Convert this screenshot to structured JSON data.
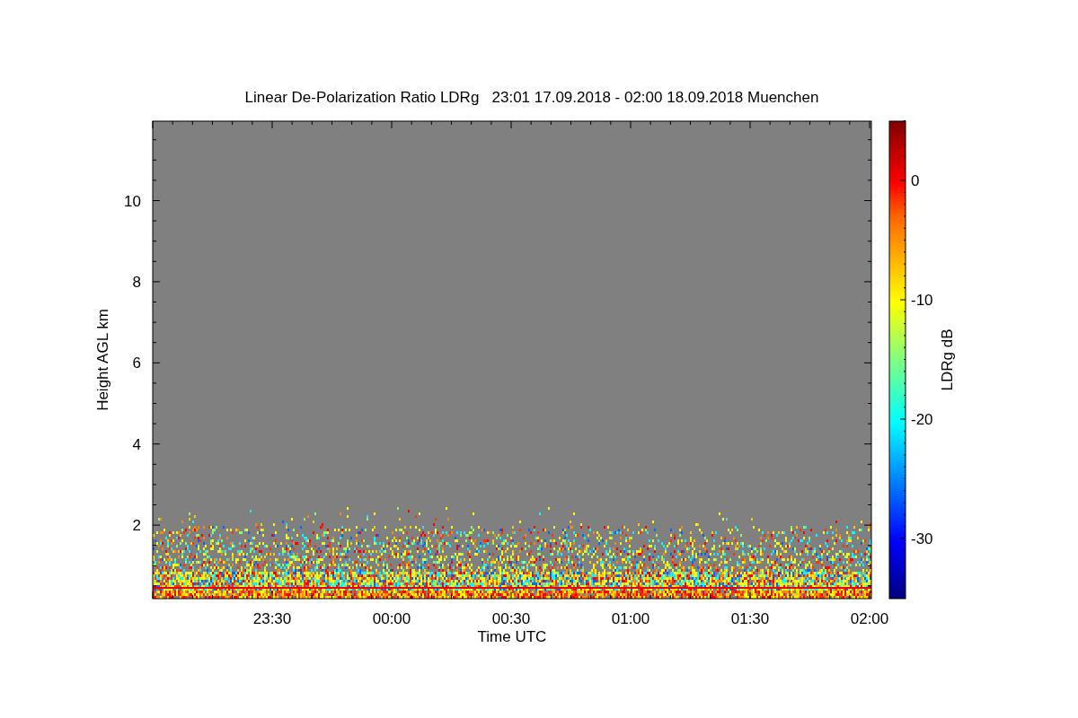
{
  "plot": {
    "title": "Linear De-Polarization Ratio LDRg   23:01 17.09.2018 - 02:00 18.09.2018 Muenchen",
    "ylabel": "Height AGL km",
    "xlabel": "Time UTC",
    "yticks": [
      "10",
      "8",
      "6",
      "4",
      "2"
    ],
    "xticks": [
      "23:30",
      "00:00",
      "00:30",
      "01:00",
      "01:30",
      "02:00"
    ]
  },
  "colorbar": {
    "label": "LDRg dB",
    "ticks": [
      "0",
      "-10",
      "-20",
      "-30"
    ]
  }
}
